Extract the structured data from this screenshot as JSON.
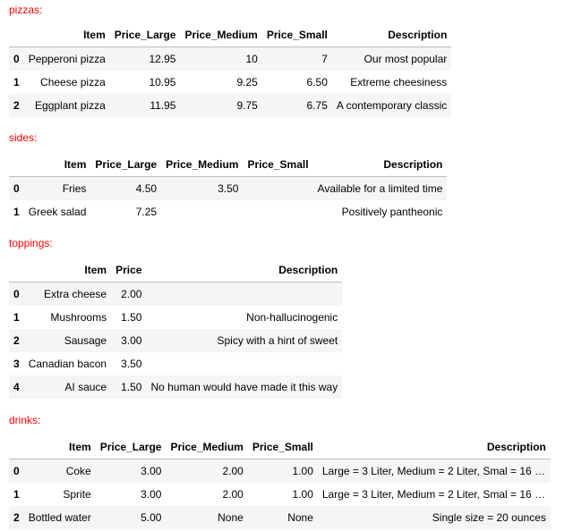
{
  "pizzas": {
    "title": "pizzas:",
    "columns": [
      "",
      "Item",
      "Price_Large",
      "Price_Medium",
      "Price_Small",
      "Description"
    ],
    "rows": [
      [
        "0",
        "Pepperoni pizza",
        "12.95",
        "10",
        "7",
        "Our most popular"
      ],
      [
        "1",
        "Cheese pizza",
        "10.95",
        "9.25",
        "6.50",
        "Extreme cheesiness"
      ],
      [
        "2",
        "Eggplant pizza",
        "11.95",
        "9.75",
        "6.75",
        "A contemporary classic"
      ]
    ]
  },
  "sides": {
    "title": "sides:",
    "columns": [
      "",
      "Item",
      "Price_Large",
      "Price_Medium",
      "Price_Small",
      "Description"
    ],
    "rows": [
      [
        "0",
        "Fries",
        "4.50",
        "3.50",
        "",
        "Available for a limited time"
      ],
      [
        "1",
        "Greek salad",
        "7.25",
        "",
        "",
        "Positively pantheonic"
      ]
    ]
  },
  "toppings": {
    "title": "toppings:",
    "columns": [
      "",
      "Item",
      "Price",
      "Description"
    ],
    "rows": [
      [
        "0",
        "Extra cheese",
        "2.00",
        ""
      ],
      [
        "1",
        "Mushrooms",
        "1.50",
        "Non-hallucinogenic"
      ],
      [
        "2",
        "Sausage",
        "3.00",
        "Spicy with a hint of sweet"
      ],
      [
        "3",
        "Canadian bacon",
        "3.50",
        ""
      ],
      [
        "4",
        "AI sauce",
        "1.50",
        "No human would have made it this way"
      ]
    ]
  },
  "drinks": {
    "title": "drinks:",
    "columns": [
      "",
      "Item",
      "Price_Large",
      "Price_Medium",
      "Price_Small",
      "Description"
    ],
    "rows": [
      [
        "0",
        "Coke",
        "3.00",
        "2.00",
        "1.00",
        "Large = 3 Liter, Medium = 2 Liter, Smal = 16 o..."
      ],
      [
        "1",
        "Sprite",
        "3.00",
        "2.00",
        "1.00",
        "Large = 3 Liter, Medium = 2 Liter, Smal = 16 o..."
      ],
      [
        "2",
        "Bottled water",
        "5.00",
        "None",
        "None",
        "Single size = 20 ounces"
      ]
    ]
  }
}
